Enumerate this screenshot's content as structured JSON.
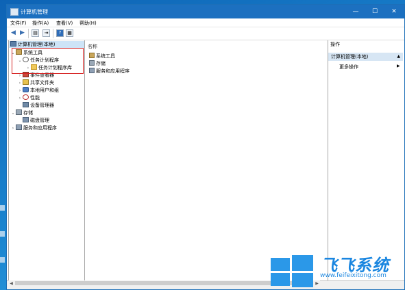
{
  "window": {
    "title": "计算机管理",
    "controls": {
      "minimize": "—",
      "maximize": "☐",
      "close": "✕"
    }
  },
  "menubar": [
    "文件(F)",
    "操作(A)",
    "查看(V)",
    "帮助(H)"
  ],
  "toolbar": [
    "back-icon",
    "forward-icon",
    "show-hide-tree-icon",
    "export-icon",
    "help-icon",
    "properties-icon"
  ],
  "tree": {
    "root": "计算机管理(本地)",
    "items": [
      {
        "label": "系统工具",
        "icon": "tools-icon",
        "twisty": "⌄",
        "level": 1
      },
      {
        "label": "任务计划程序",
        "icon": "clock-icon",
        "twisty": "⌄",
        "level": 2
      },
      {
        "label": "任务计划程序库",
        "icon": "folder-icon",
        "twisty": "›",
        "level": 3
      },
      {
        "label": "事件查看器",
        "icon": "event-viewer-icon",
        "twisty": "›",
        "level": 2
      },
      {
        "label": "共享文件夹",
        "icon": "shared-folder-icon",
        "twisty": "›",
        "level": 2
      },
      {
        "label": "本地用户和组",
        "icon": "users-icon",
        "twisty": "›",
        "level": 2
      },
      {
        "label": "性能",
        "icon": "performance-icon",
        "twisty": "›",
        "level": 2
      },
      {
        "label": "设备管理器",
        "icon": "device-manager-icon",
        "twisty": "",
        "level": 2
      },
      {
        "label": "存储",
        "icon": "storage-icon",
        "twisty": "⌄",
        "level": 1
      },
      {
        "label": "磁盘管理",
        "icon": "disk-icon",
        "twisty": "",
        "level": 2
      },
      {
        "label": "服务和应用程序",
        "icon": "services-icon",
        "twisty": "›",
        "level": 1
      }
    ]
  },
  "main": {
    "column_header": "名称",
    "items": [
      {
        "label": "系统工具",
        "icon": "tools-icon"
      },
      {
        "label": "存储",
        "icon": "storage-icon"
      },
      {
        "label": "服务和应用程序",
        "icon": "services-icon"
      }
    ]
  },
  "actions": {
    "header": "操作",
    "group": "计算机管理(本地)",
    "items": [
      {
        "label": "更多操作"
      }
    ]
  },
  "watermark": {
    "text": "飞飞系统",
    "url": "www.feifeixitong.com"
  },
  "colors": {
    "titlebar": "#1c70c0",
    "highlight": "#d62424",
    "action_group": "#d7e6f4",
    "watermark": "#1a86e0"
  }
}
